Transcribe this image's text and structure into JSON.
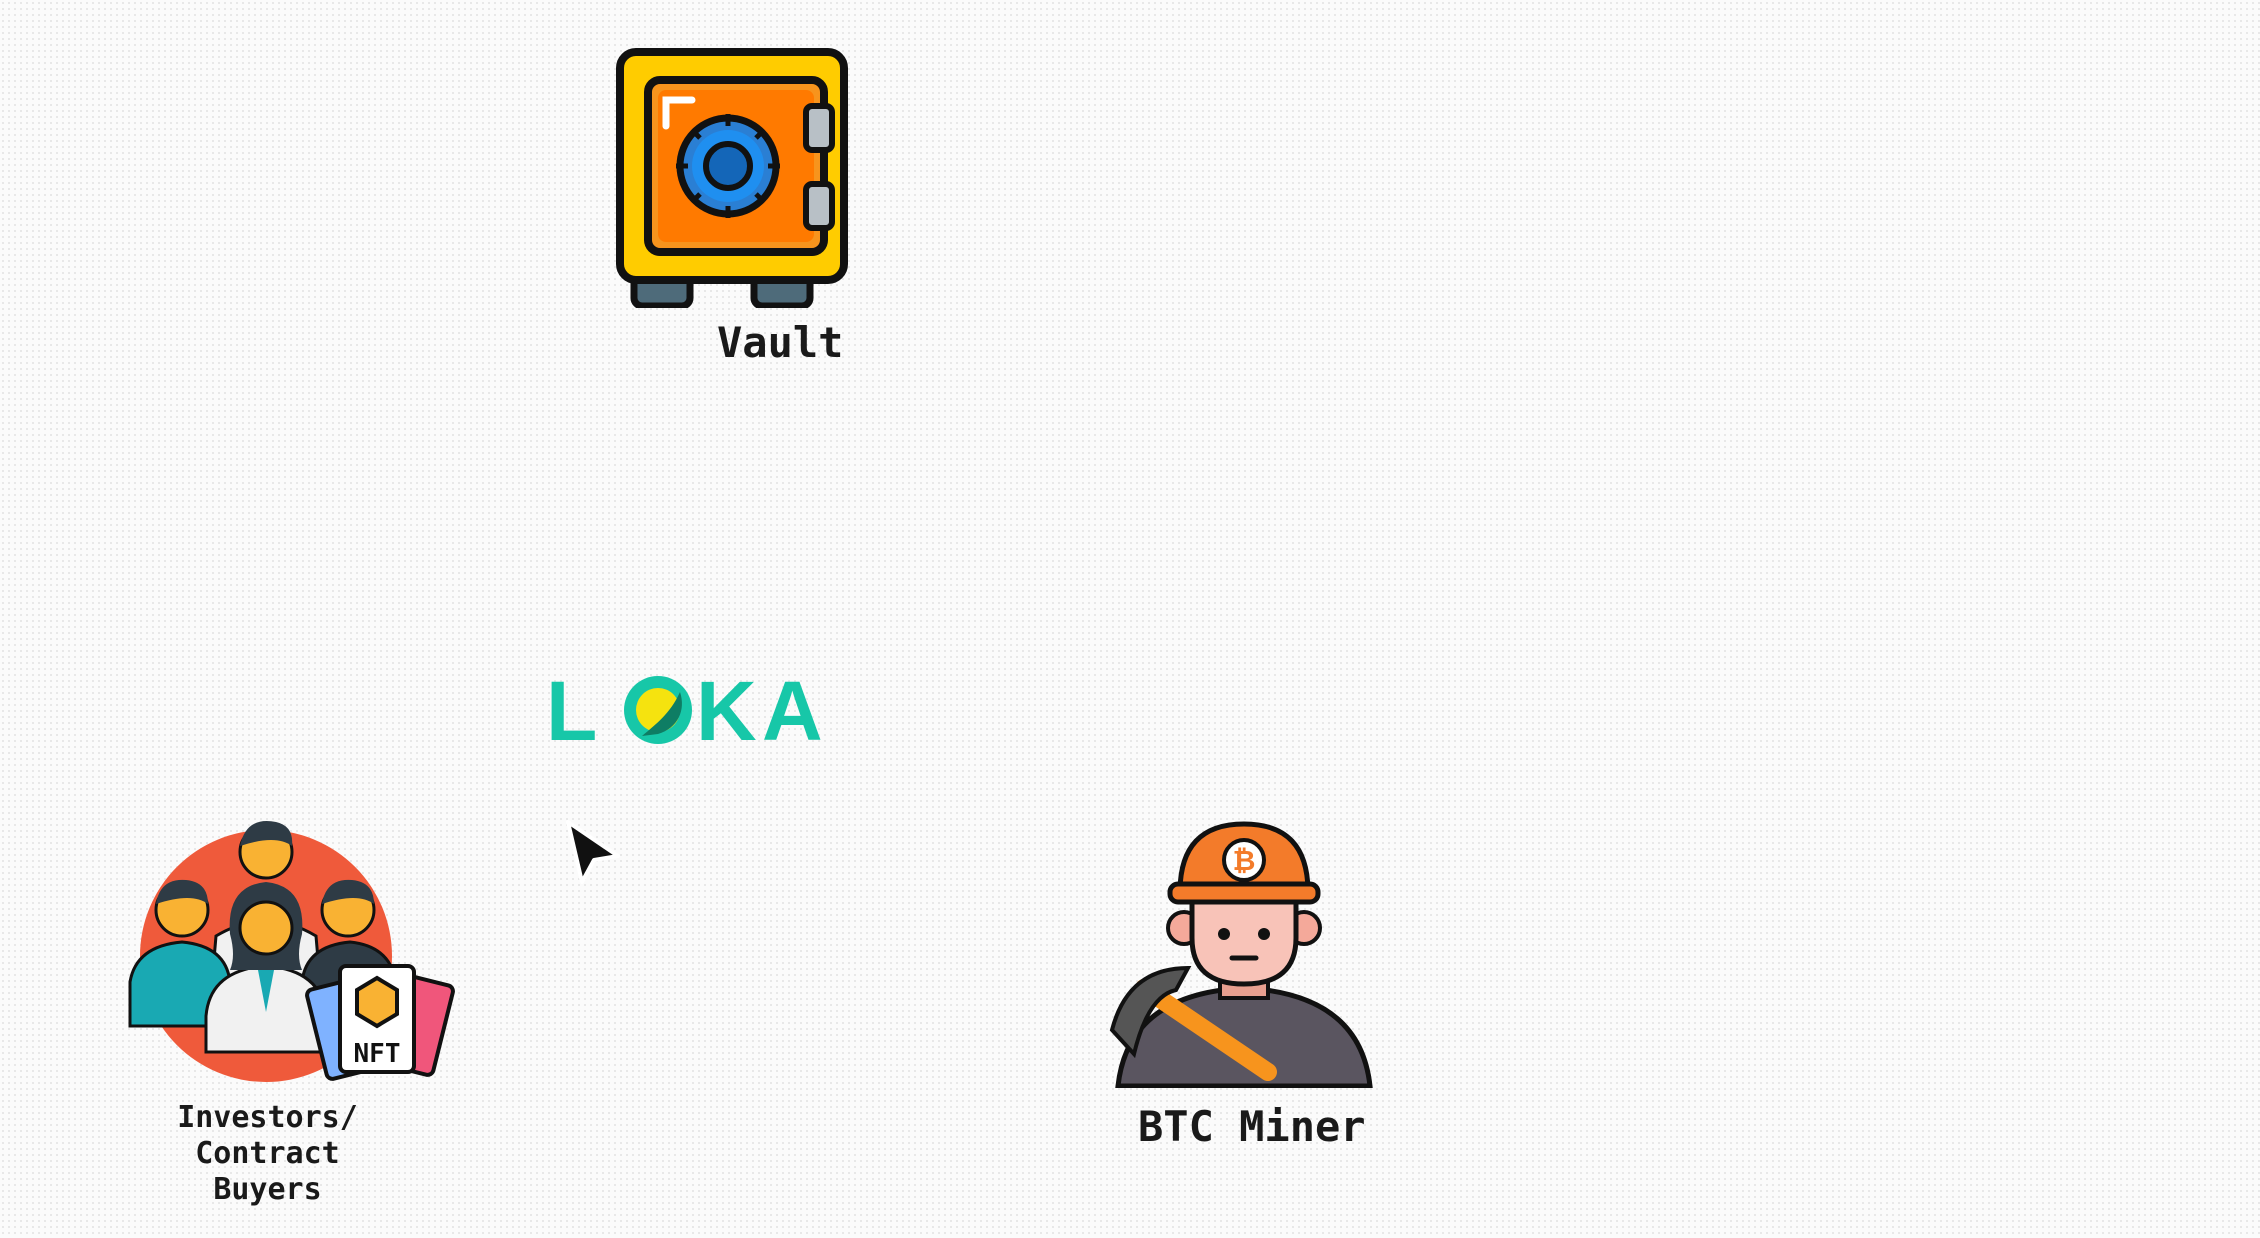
{
  "vault": {
    "label": "Vault",
    "icon": "safe-vault-icon"
  },
  "logo": {
    "text": "LOKA",
    "letters": [
      "L",
      "O",
      "K",
      "A"
    ],
    "color": "#17c7a8",
    "accent": "#f5e30f"
  },
  "investors": {
    "label_line1": "Investors/",
    "label_line2": "Contract Buyers",
    "icon": "investor-group-icon",
    "badge": "NFT"
  },
  "miner": {
    "label": "BTC Miner",
    "icon": "btc-miner-icon",
    "coin_symbol": "₿"
  },
  "cursor": {
    "icon": "mouse-pointer-icon"
  }
}
